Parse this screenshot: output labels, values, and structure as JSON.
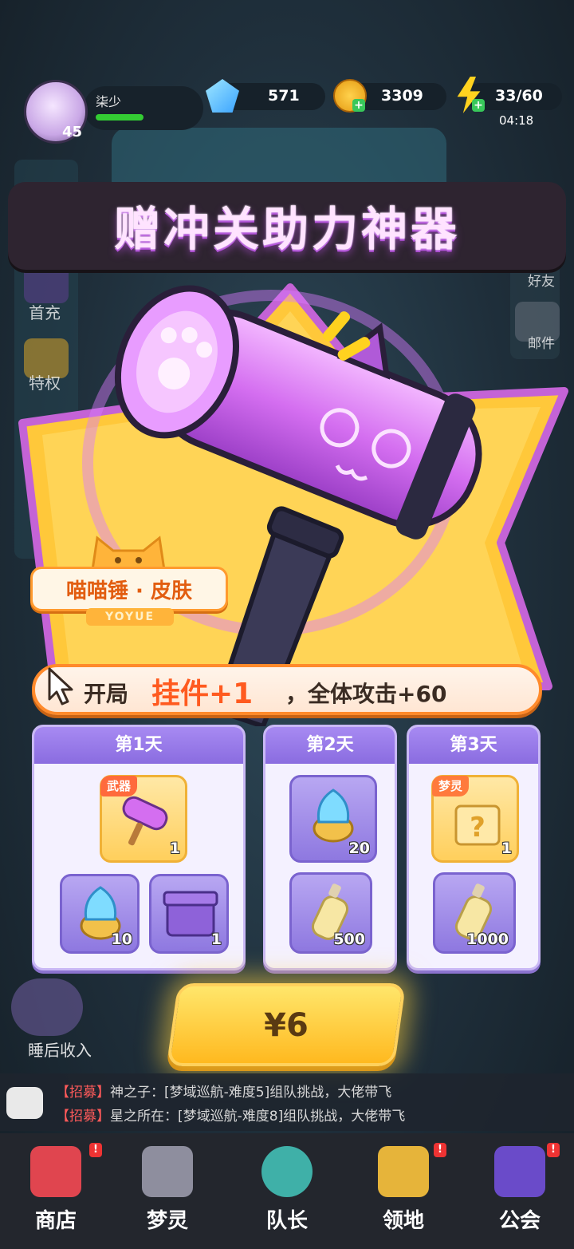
{
  "player": {
    "name": "柒少",
    "level": "45"
  },
  "resources": {
    "gems": "571",
    "coins": "3309",
    "energy": "33/60",
    "energy_timer": "04:18"
  },
  "side_left": {
    "first_charge": "首充",
    "privilege": "特权",
    "sleep_income": "睡后收入"
  },
  "side_right": {
    "friends": "好友",
    "mail": "邮件"
  },
  "promo": {
    "title": "赠冲关助力神器",
    "skin_tag": "喵喵锤 · 皮肤",
    "brand": "YOYUE",
    "perk_prefix": "开局",
    "perk_highlight": "挂件+1",
    "perk_suffix": "，全体攻击+60"
  },
  "days": [
    {
      "title": "第1天",
      "items": [
        {
          "name": "hammer-weapon",
          "tag": "武器",
          "qty": "1"
        },
        {
          "name": "blue-flame-orb",
          "qty": "10"
        },
        {
          "name": "purple-box",
          "qty": "1"
        }
      ]
    },
    {
      "title": "第2天",
      "items": [
        {
          "name": "blue-flame-orb",
          "qty": "20"
        },
        {
          "name": "potion-bottle",
          "qty": "500"
        }
      ]
    },
    {
      "title": "第3天",
      "items": [
        {
          "name": "mystery-box",
          "tag": "梦灵",
          "qty": "1"
        },
        {
          "name": "potion-bottle",
          "qty": "1000"
        }
      ]
    }
  ],
  "buy_button": {
    "label": "¥6"
  },
  "chat": [
    {
      "tag": "【招募】",
      "msg": "神之子：[梦域巡航-难度5]组队挑战，大佬带飞"
    },
    {
      "tag": "【招募】",
      "msg": "星之所在：[梦域巡航-难度8]组队挑战，大佬带飞"
    }
  ],
  "nav": [
    "商店",
    "梦灵",
    "队长",
    "领地",
    "公会"
  ],
  "colors": {
    "accent_orange": "#ff8a2b",
    "card_purple": "#8a6ce0",
    "button_gold": "#ffb91f"
  }
}
